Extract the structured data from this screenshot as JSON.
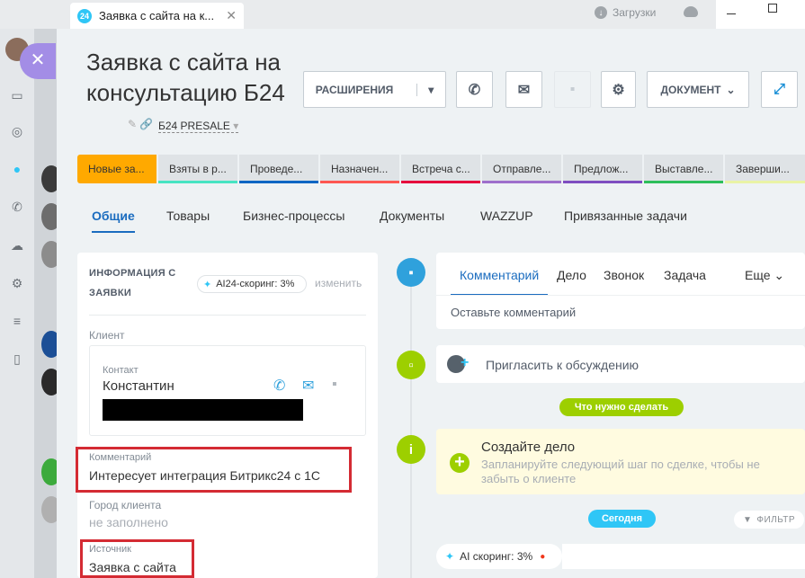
{
  "browser": {
    "tab_badge": "24",
    "tab_title": "Заявка с сайта на к...",
    "tab_close": "✕",
    "downloads_label": "Загрузки",
    "downloads_icon": "↓"
  },
  "sidebar": {
    "close_label": "✕"
  },
  "header": {
    "title": "Заявка с сайта на консультацию Б24",
    "edit_icon": "✎ 🔗",
    "pipeline": "Б24 PRESALE",
    "pipeline_caret": "▾",
    "extensions_label": "РАСШИРЕНИЯ",
    "extensions_caret": "▾",
    "document_label": "ДОКУМЕНТ",
    "document_caret": "⌄",
    "call_icon": "✆",
    "mail_icon": "✉",
    "chat_icon": "▪",
    "gear_icon": "⚙",
    "resize_icon": "⤢"
  },
  "stages": [
    {
      "label": "Новые за...",
      "color": "#ffa900",
      "active": true
    },
    {
      "label": "Взяты в р...",
      "color": "#47e4c2"
    },
    {
      "label": "Проведе...",
      "color": "#0b66c3"
    },
    {
      "label": "Назначен...",
      "color": "#ff5752"
    },
    {
      "label": "Встреча с...",
      "color": "#e6003c"
    },
    {
      "label": "Отправле...",
      "color": "#9e6fcc"
    },
    {
      "label": "Предлож...",
      "color": "#7e4ec0"
    },
    {
      "label": "Выставле...",
      "color": "#2dbe5a"
    },
    {
      "label": "Заверши...",
      "color": "#e9f3a5"
    }
  ],
  "tabs": [
    {
      "label": "Общие",
      "active": true
    },
    {
      "label": "Товары"
    },
    {
      "label": "Бизнес-процессы"
    },
    {
      "label": "Документы"
    },
    {
      "label": "WAZZUP"
    },
    {
      "label": "Привязанные задачи"
    }
  ],
  "info": {
    "section_title": "ИНФОРМАЦИЯ С ЗАЯВКИ",
    "ai_score": "AI24-скоринг: 3%",
    "change_link": "изменить",
    "client_label": "Клиент",
    "contact_label": "Контакт",
    "contact_name": "Константин",
    "comment_label": "Комментарий",
    "comment_value": "Интересует интеграция Битрикс24 с 1С",
    "city_label": "Город клиента",
    "city_value": "не заполнено",
    "source_label": "Источник",
    "source_value": "Заявка с сайта"
  },
  "timeline": {
    "tabs": [
      "Комментарий",
      "Дело",
      "Звонок",
      "Задача"
    ],
    "more_label": "Еще",
    "more_caret": "⌄",
    "comment_placeholder": "Оставьте комментарий",
    "invite_text": "Пригласить к обсуждению",
    "invite_plus": "+",
    "todo_pill": "Что нужно сделать",
    "task_title": "Создайте дело",
    "task_plus": "+",
    "task_sub": "Запланируйте следующий шаг по сделке, чтобы не забыть о клиенте",
    "info_icon": "i",
    "today_pill": "Сегодня",
    "filter_label": "ФИЛЬТР",
    "ai_scoring": "AI скоринг: 3%",
    "ai_dot": "●"
  }
}
